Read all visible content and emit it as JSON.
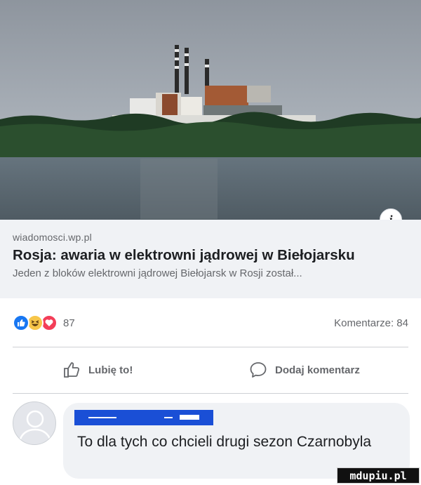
{
  "post": {
    "link_preview": {
      "image_alt": "Nuclear power plant across a lake",
      "info_glyph": "i",
      "domain": "wiadomosci.wp.pl",
      "title": "Rosja: awaria w elektrowni jądrowej w Biełojarsku",
      "description": "Jeden z bloków elektrowni jądrowej Biełojarsk w Rosji został..."
    },
    "reactions": {
      "types": [
        "like-icon",
        "haha-icon",
        "love-icon"
      ],
      "count": "87",
      "comments_label": "Komentarze: 84"
    },
    "actions": {
      "like_label": "Lubię to!",
      "comment_label": "Dodaj komentarz"
    },
    "comment": {
      "author_redacted": true,
      "text": "To dla tych co chcieli drugi sezon Czarnobyla"
    }
  },
  "watermark": "mdupiu.pl",
  "colors": {
    "link_box_bg": "#f0f2f5",
    "like_blue": "#1877f2",
    "haha_yellow": "#f7c64a",
    "love_red": "#f33e58",
    "redaction_blue": "#1a4fd6"
  }
}
